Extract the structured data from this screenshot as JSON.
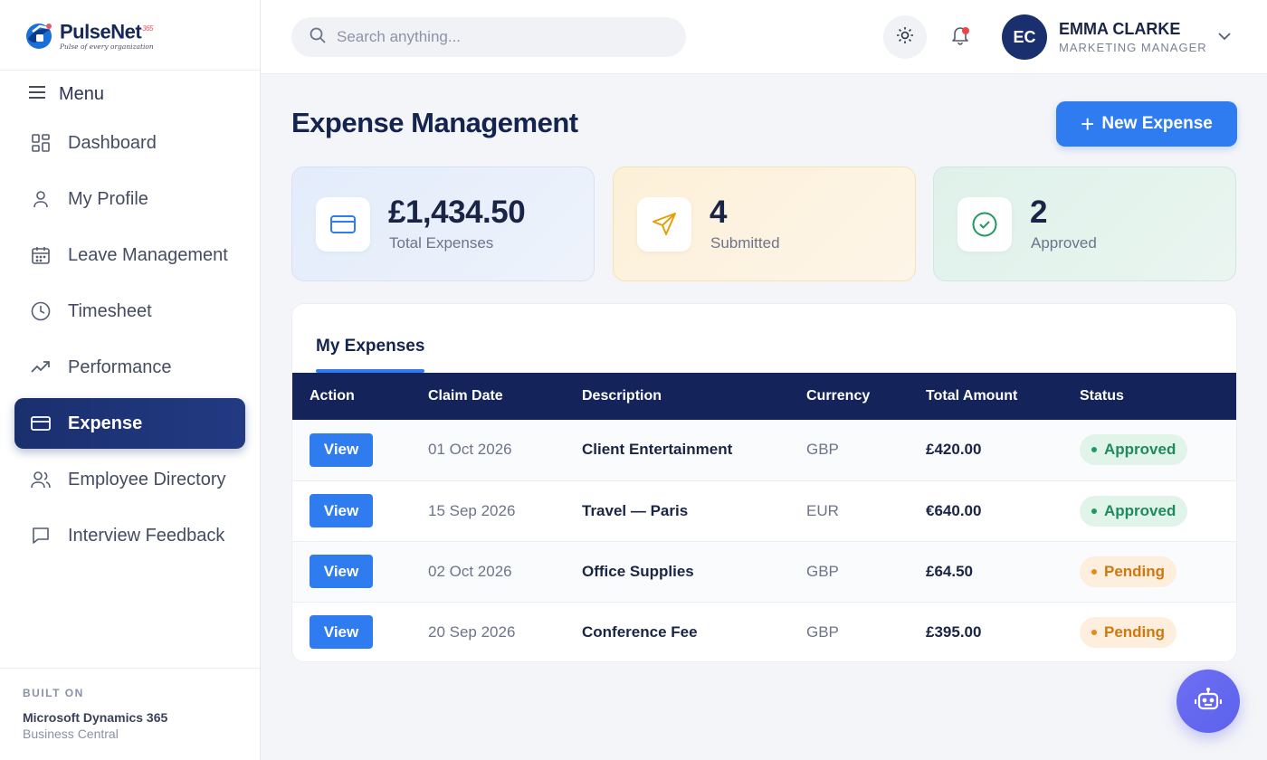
{
  "brand": {
    "name": "PulseNet",
    "suffix": "365",
    "tagline": "Pulse of every organization"
  },
  "sidebar": {
    "menu_label": "Menu",
    "items": [
      {
        "label": "Dashboard",
        "icon": "dashboard-icon"
      },
      {
        "label": "My Profile",
        "icon": "user-icon"
      },
      {
        "label": "Leave Management",
        "icon": "calendar-icon"
      },
      {
        "label": "Timesheet",
        "icon": "clock-icon"
      },
      {
        "label": "Performance",
        "icon": "trending-icon"
      },
      {
        "label": "Expense",
        "icon": "card-icon",
        "active": true
      },
      {
        "label": "Employee Directory",
        "icon": "users-icon"
      },
      {
        "label": "Interview Feedback",
        "icon": "chat-icon"
      }
    ],
    "footer": {
      "label": "BUILT ON",
      "product": "Microsoft Dynamics 365",
      "edition": "Business Central"
    }
  },
  "header": {
    "search_placeholder": "Search anything...",
    "user": {
      "initials": "EC",
      "name": "EMMA CLARKE",
      "role": "MARKETING MANAGER"
    }
  },
  "main": {
    "title": "Expense Management",
    "new_button": "New Expense",
    "stats": [
      {
        "value": "£1,434.50",
        "label": "Total Expenses",
        "icon": "card-icon"
      },
      {
        "value": "4",
        "label": "Submitted",
        "icon": "send-icon"
      },
      {
        "value": "2",
        "label": "Approved",
        "icon": "check-circle-icon"
      }
    ],
    "tab": "My Expenses",
    "columns": [
      "Action",
      "Claim Date",
      "Description",
      "Currency",
      "Total Amount",
      "Status"
    ],
    "rows": [
      {
        "action": "View",
        "date": "01 Oct 2026",
        "description": "Client Entertainment",
        "currency": "GBP",
        "amount": "£420.00",
        "status": "Approved"
      },
      {
        "action": "View",
        "date": "15 Sep 2026",
        "description": "Travel — Paris",
        "currency": "EUR",
        "amount": "€640.00",
        "status": "Approved"
      },
      {
        "action": "View",
        "date": "02 Oct 2026",
        "description": "Office Supplies",
        "currency": "GBP",
        "amount": "£64.50",
        "status": "Pending"
      },
      {
        "action": "View",
        "date": "20 Sep 2026",
        "description": "Conference Fee",
        "currency": "GBP",
        "amount": "£395.00",
        "status": "Pending"
      }
    ]
  },
  "colors": {
    "accent": "#2f7cf0",
    "navy": "#14245a",
    "approved": "#1f8b5c",
    "pending": "#d0780e",
    "bot": "#6e6ff5"
  }
}
